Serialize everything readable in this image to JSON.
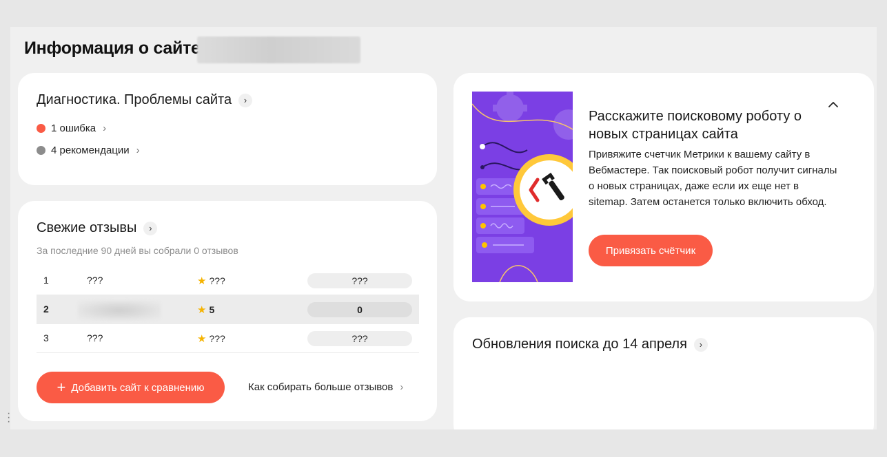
{
  "page": {
    "title": "Информация о сайте"
  },
  "diagnostics": {
    "title": "Диагностика. Проблемы сайта",
    "items": [
      {
        "label": "1 ошибка",
        "color": "#fa5b45"
      },
      {
        "label": "4 рекомендации",
        "color": "#8c8c8c"
      }
    ]
  },
  "reviews": {
    "title": "Свежие отзывы",
    "subtitle": "За последние 90 дней вы собрали 0 отзывов",
    "rows": [
      {
        "rank": "1",
        "site": "???",
        "rating": "???",
        "count": "???"
      },
      {
        "rank": "2",
        "site": "",
        "rating": "5",
        "count": "0"
      },
      {
        "rank": "3",
        "site": "???",
        "rating": "???",
        "count": "???"
      }
    ],
    "add_button": "Добавить сайт к сравнению",
    "more_link": "Как собирать больше отзывов"
  },
  "promo": {
    "title": "Расскажите поисковому роботу о новых страницах сайта",
    "text": "Привяжите счетчик Метрики к вашему сайту в Вебмастере. Так поисковый робот получит сигналы о новых страницах, даже если их еще нет в sitemap. Затем останется только включить обход.",
    "button": "Привязать счётчик"
  },
  "updates": {
    "title": "Обновления поиска до 14 апреля"
  },
  "colors": {
    "accent": "#fa5b45",
    "illustration_bg": "#7b3fe4",
    "star": "#f5b301"
  }
}
